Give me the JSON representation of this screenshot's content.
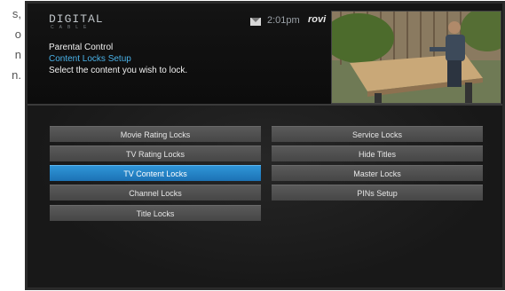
{
  "caption_fragments": [
    "s,",
    "o",
    "n",
    "n."
  ],
  "header": {
    "logo_text": "DIGITAL",
    "logo_subtext": "CABLE",
    "clock": "2:01pm",
    "brand": "rovi",
    "title": "Parental Control",
    "subtitle": "Content Locks Setup",
    "instruction": "Select the content you wish to lock."
  },
  "menu": {
    "left": [
      {
        "label": "Movie Rating Locks",
        "selected": false
      },
      {
        "label": "TV Rating Locks",
        "selected": false
      },
      {
        "label": "TV Content Locks",
        "selected": true
      },
      {
        "label": "Channel Locks",
        "selected": false
      },
      {
        "label": "Title Locks",
        "selected": false
      }
    ],
    "right": [
      {
        "label": "Service Locks",
        "selected": false
      },
      {
        "label": "Hide Titles",
        "selected": false
      },
      {
        "label": "Master Locks",
        "selected": false
      },
      {
        "label": "PINs Setup",
        "selected": false
      }
    ]
  },
  "colors": {
    "accent": "#2a8fd2",
    "subtitle": "#4ab2e8",
    "button": "#505050"
  }
}
